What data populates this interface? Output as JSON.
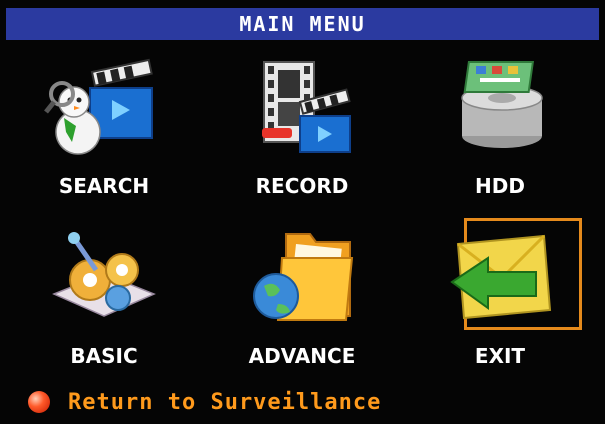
{
  "header": {
    "title": "MAIN MENU"
  },
  "menu": {
    "items": [
      {
        "label": "SEARCH",
        "icon": "search-icon",
        "selected": false
      },
      {
        "label": "RECORD",
        "icon": "record-icon",
        "selected": false
      },
      {
        "label": "HDD",
        "icon": "hdd-icon",
        "selected": false
      },
      {
        "label": "BASIC",
        "icon": "basic-settings-icon",
        "selected": false
      },
      {
        "label": "ADVANCE",
        "icon": "advance-folder-icon",
        "selected": false
      },
      {
        "label": "EXIT",
        "icon": "exit-icon",
        "selected": true
      }
    ]
  },
  "footer": {
    "text": "Return to Surveillance",
    "icon": "red-dot-icon"
  },
  "colors": {
    "title_bar": "#2b3aa0",
    "background": "#050505",
    "selection_border": "#e58a1c",
    "footer_text": "#ff9a1c",
    "label_text": "#ffffff"
  }
}
